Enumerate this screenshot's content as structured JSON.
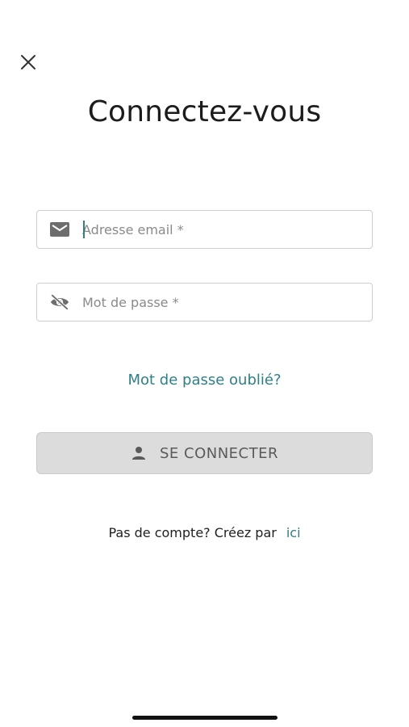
{
  "header": {
    "close_icon": "close-icon",
    "title": "Connectez-vous"
  },
  "form": {
    "email": {
      "icon": "mail-icon",
      "placeholder": "Adresse email *",
      "value": ""
    },
    "password": {
      "icon": "eye-off-icon",
      "placeholder": "Mot de passe *",
      "value": ""
    },
    "forgot_label": "Mot de passe oublié?",
    "submit": {
      "icon": "person-icon",
      "label": "SE CONNECTER"
    }
  },
  "signup": {
    "prompt": "Pas de compte? Créez par",
    "link_label": "ici"
  },
  "colors": {
    "accent": "#2f7f86",
    "button_bg": "#dcdcdc",
    "button_text": "#5a5a5a",
    "field_border": "#cfcfcf"
  }
}
